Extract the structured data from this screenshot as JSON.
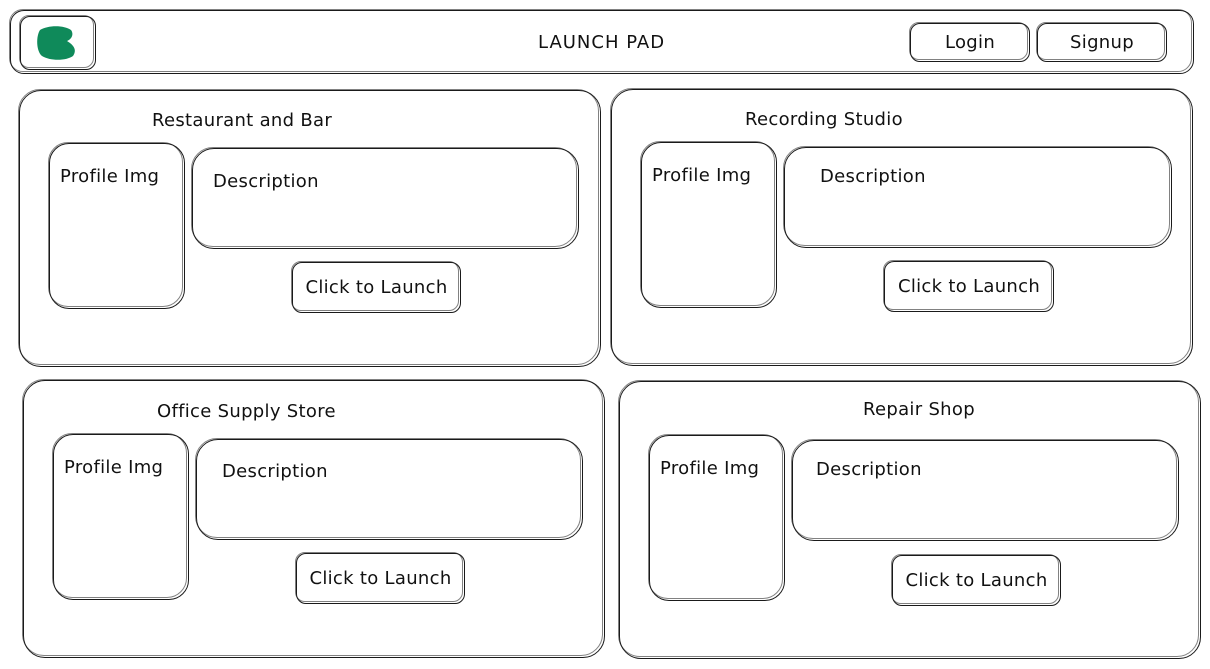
{
  "header": {
    "title": "LAUNCH PAD",
    "login_label": "Login",
    "signup_label": "Signup",
    "logo_icon": "leaf-logo-icon",
    "logo_color": "#0f8a5a"
  },
  "cards": [
    {
      "title": "Restaurant and Bar",
      "profile_label": "Profile Img",
      "description_label": "Description",
      "launch_label": "Click to Launch"
    },
    {
      "title": "Recording Studio",
      "profile_label": "Profile Img",
      "description_label": "Description",
      "launch_label": "Click to Launch"
    },
    {
      "title": "Office Supply Store",
      "profile_label": "Profile Img",
      "description_label": "Description",
      "launch_label": "Click to Launch"
    },
    {
      "title": "Repair Shop",
      "profile_label": "Profile Img",
      "description_label": "Description",
      "launch_label": "Click to Launch"
    }
  ]
}
